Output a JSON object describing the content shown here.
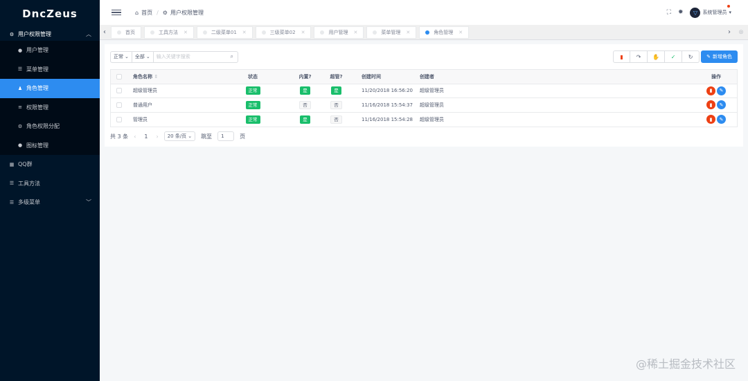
{
  "app": {
    "title": "DncZeus"
  },
  "sidebar": {
    "group": {
      "label": "用户权限管理",
      "icon": "gear-icon"
    },
    "sub_items": [
      {
        "label": "用户管理",
        "icon": "user-icon"
      },
      {
        "label": "菜单管理",
        "icon": "menu-icon"
      },
      {
        "label": "角色管理",
        "icon": "users-icon",
        "active": true
      },
      {
        "label": "权限管理",
        "icon": "list-icon"
      },
      {
        "label": "角色权限分配",
        "icon": "gear-icon"
      },
      {
        "label": "图标管理",
        "icon": "circle-icon"
      }
    ],
    "items": [
      {
        "label": "QQ群",
        "icon": "grid-icon"
      },
      {
        "label": "工具方法",
        "icon": "menu-icon"
      },
      {
        "label": "多级菜单",
        "icon": "menu-icon"
      }
    ]
  },
  "header": {
    "breadcrumb": [
      {
        "label": "首页",
        "icon": "home-icon"
      },
      {
        "label": "用户权限管理",
        "icon": "gear-icon"
      }
    ],
    "user_name": "系统管理员"
  },
  "tabs": [
    {
      "label": "首页",
      "closable": false
    },
    {
      "label": "工具方法",
      "closable": true
    },
    {
      "label": "二级菜单01",
      "closable": true
    },
    {
      "label": "三级菜单02",
      "closable": true
    },
    {
      "label": "用户管理",
      "closable": true
    },
    {
      "label": "菜单管理",
      "closable": true
    },
    {
      "label": "角色管理",
      "closable": true,
      "active": true
    }
  ],
  "filters": {
    "status_value": "正常",
    "scope_value": "全部",
    "search_placeholder": "输入关键字搜索"
  },
  "toolbar": {
    "add_label": "新增角色"
  },
  "table": {
    "headers": {
      "name": "角色名称",
      "status": "状态",
      "builtin": "内置?",
      "super": "超管?",
      "created_time": "创建时间",
      "creator": "创建者",
      "ops": "操作"
    },
    "rows": [
      {
        "name": "超级管理员",
        "status": "正常",
        "builtin": "是",
        "super": "是",
        "created_time": "11/20/2018 16:56:20",
        "creator": "超级管理员"
      },
      {
        "name": "普通用户",
        "status": "正常",
        "builtin": "否",
        "super": "否",
        "created_time": "11/16/2018 15:54:37",
        "creator": "超级管理员"
      },
      {
        "name": "管理员",
        "status": "正常",
        "builtin": "是",
        "super": "否",
        "created_time": "11/16/2018 15:54:28",
        "creator": "超级管理员"
      }
    ]
  },
  "pager": {
    "total_text": "共 3 条",
    "current_page": "1",
    "page_size": "20 条/页",
    "jump_label": "跳至",
    "jump_value": "1",
    "page_suffix": "页"
  },
  "watermark": "@稀土掘金技术社区",
  "colors": {
    "sidebar_bg": "#001529",
    "active_blue": "#2d8cf0",
    "success_green": "#19be6b",
    "danger_red": "#ed4014"
  }
}
